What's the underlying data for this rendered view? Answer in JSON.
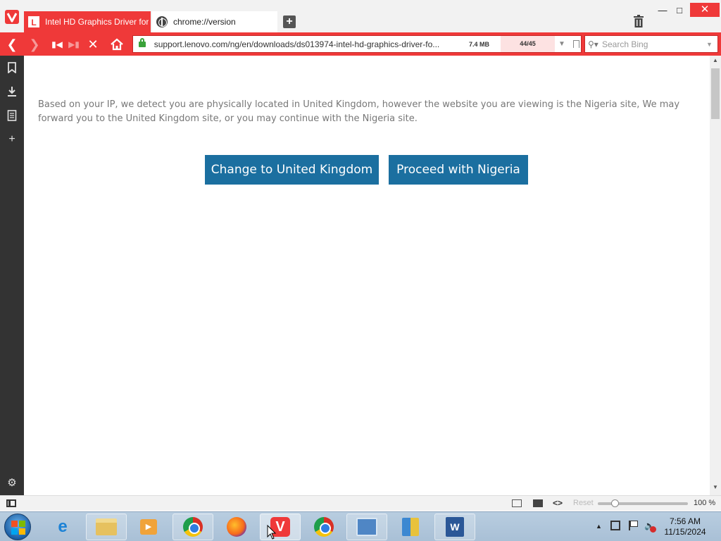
{
  "browser": {
    "tabs": [
      {
        "title": "Intel HD Graphics Driver for",
        "favicon": "L",
        "active": true
      },
      {
        "title": "chrome://version",
        "favicon": "globe-icon",
        "active": false
      }
    ],
    "address": {
      "url": "support.lenovo.com/ng/en/downloads/ds013974-intel-hd-graphics-driver-fo...",
      "download_size": "7.4 MB",
      "page_count": "44/45"
    },
    "search": {
      "placeholder": "Search Bing"
    },
    "accent_color": "#ef3939"
  },
  "page": {
    "notice": "Based on your IP, we detect you are physically located in United Kingdom, however the website you are viewing is the Nigeria site, We may forward you to the United Kingdom site, or you may continue with the Nigeria site.",
    "buttons": {
      "change": "Change to United Kingdom",
      "proceed": "Proceed with Nigeria"
    },
    "button_color": "#1b6fa0"
  },
  "statusbar": {
    "reset_label": "Reset",
    "zoom": "100 %",
    "zoom_value": 100
  },
  "taskbar": {
    "clock_time": "7:56 AM",
    "clock_date": "11/15/2024",
    "apps": [
      "internet-explorer",
      "file-explorer",
      "media-player",
      "chrome",
      "firefox",
      "vivaldi",
      "chrome",
      "control-panel",
      "package-installer",
      "word"
    ]
  }
}
